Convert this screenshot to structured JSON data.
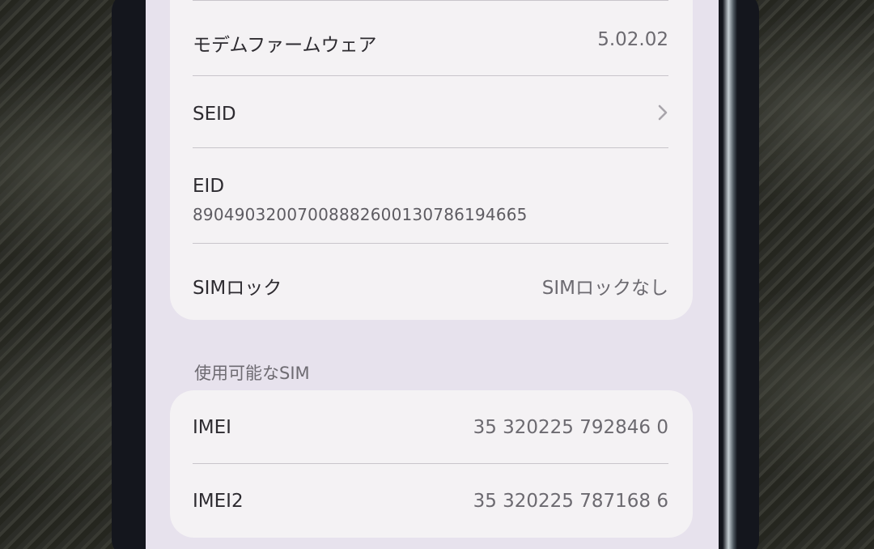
{
  "about_list": {
    "modem_firmware": {
      "label": "モデムファームウェア",
      "value": "5.02.02"
    },
    "seid": {
      "label": "SEID"
    },
    "eid": {
      "label": "EID",
      "value": "89049032007008882600130786194665"
    },
    "sim_lock": {
      "label": "SIMロック",
      "value": "SIMロックなし"
    }
  },
  "available_sim": {
    "header": "使用可能なSIM",
    "imei": {
      "label": "IMEI",
      "value": "35 320225 792846 0"
    },
    "imei2": {
      "label": "IMEI2",
      "value": "35 320225 787168 6"
    }
  },
  "icons": {
    "seid_disclosure": "chevron-right-icon"
  },
  "colors": {
    "screen_background": "#e7e2ed",
    "card_background": "#f4f2f4",
    "primary_text": "#2d2b30",
    "secondary_text": "#6c6a70",
    "chevron": "#a8a5ab"
  }
}
